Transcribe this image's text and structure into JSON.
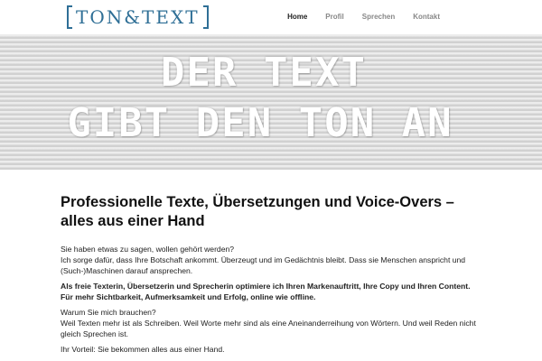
{
  "logo": {
    "text": "TON&TEXT"
  },
  "nav": {
    "items": [
      {
        "label": "Home",
        "active": true
      },
      {
        "label": "Profil",
        "active": false
      },
      {
        "label": "Sprechen",
        "active": false
      },
      {
        "label": "Kontakt",
        "active": false
      }
    ]
  },
  "hero": {
    "line1": "DER TEXT",
    "line2": "GIBT DEN TON AN"
  },
  "main": {
    "headline": "Professionelle Texte, Übersetzungen und Voice-Overs – alles aus einer Hand",
    "p1_line1": "Sie haben etwas zu sagen, wollen gehört werden?",
    "p1_line2": "Ich sorge dafür, dass Ihre Botschaft ankommt. Überzeugt und im Gedächtnis bleibt. Dass sie Menschen anspricht und (Such-)Maschinen darauf ansprechen.",
    "p2_line1": "Als freie Texterin, Übersetzerin und Sprecherin optimiere ich Ihren Markenauftritt, Ihre Copy und Ihren Content.",
    "p2_line2": "Für mehr Sichtbarkeit, Aufmerksamkeit und Erfolg, online wie offline.",
    "p3_line1": "Warum Sie mich brauchen?",
    "p3_line2": "Weil Texten mehr ist als Schreiben. Weil Worte mehr sind als eine Aneinanderreihung von Wörtern. Und weil Reden nicht gleich Sprechen ist.",
    "p4": "Ihr Vorteil: Sie bekommen alles aus einer Hand."
  },
  "colors": {
    "brand": "#2f6f96",
    "nav_inactive": "#888888",
    "nav_active": "#222222"
  }
}
